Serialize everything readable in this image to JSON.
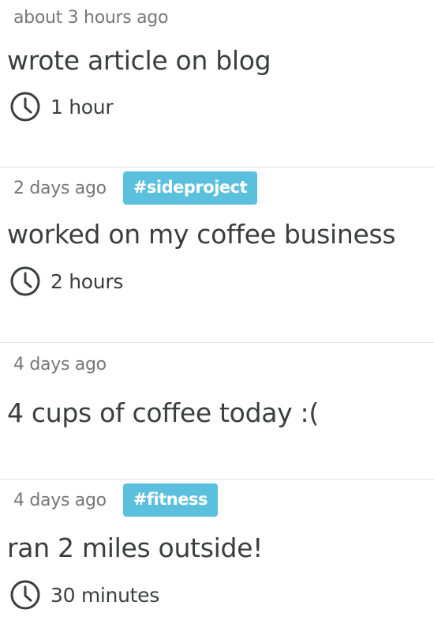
{
  "entries": [
    {
      "time": "about 3 hours ago",
      "tag": null,
      "title": "wrote article on blog",
      "duration": "1 hour",
      "clock_icon": "clock-icon"
    },
    {
      "time": "2 days ago",
      "tag": "#sideproject",
      "title": "worked on my coffee business",
      "duration": "2 hours",
      "clock_icon": "clock-icon"
    },
    {
      "time": "4 days ago",
      "tag": null,
      "title": "4 cups of coffee today :(",
      "duration": null
    },
    {
      "time": "4 days ago",
      "tag": "#fitness",
      "title": "ran 2 miles outside!",
      "duration": "30 minutes",
      "clock_icon": "clock-icon"
    }
  ],
  "colors": {
    "tag_background": "#5bc0de",
    "tag_text": "#ffffff",
    "timestamp_text": "#777777",
    "title_text": "#3b3d40",
    "divider": "#e3e3e3"
  }
}
